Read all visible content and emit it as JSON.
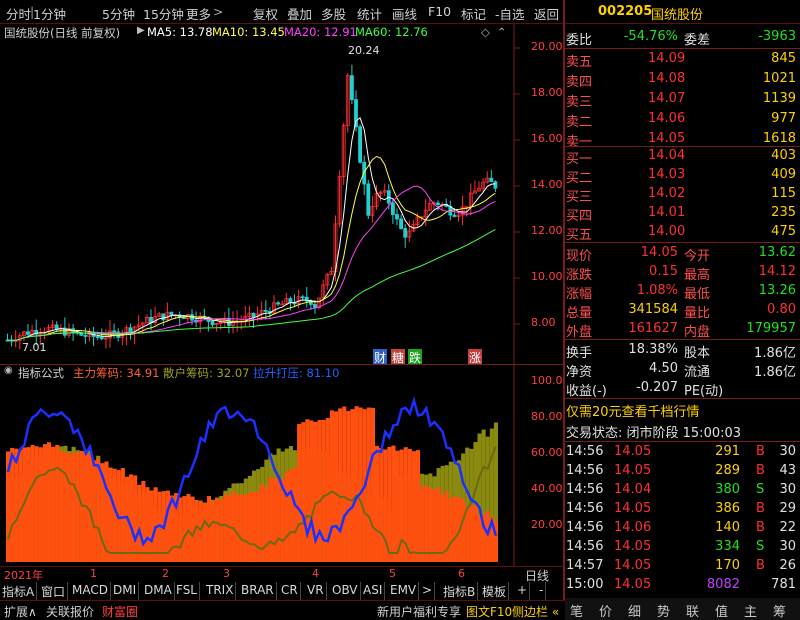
{
  "toolbar": {
    "items": [
      "分时",
      "1分钟",
      "5分钟",
      "15分钟",
      "更多",
      "复权",
      "叠加",
      "多股",
      "统计",
      "画线",
      "F10",
      "标记",
      "-自选",
      "返回"
    ]
  },
  "stock": {
    "code": "002205",
    "name": "国统股份"
  },
  "kline": {
    "title": "国统股份(日线 前复权)",
    "ma5": "MA5: 13.78",
    "ma10": "MA10: 13.45",
    "ma20": "MA20: 12.91",
    "ma60": "MA60: 12.76",
    "high_label": "20.24",
    "low_label": "7.01",
    "y_ticks": [
      "20.00",
      "18.00",
      "16.00",
      "14.00",
      "12.00",
      "10.00",
      "8.00"
    ],
    "markers": [
      "财",
      "糖",
      "跌",
      "涨"
    ]
  },
  "indicator": {
    "title": "指标公式",
    "main_label": "主力筹码: 34.91",
    "retail_label": "散户筹码: 32.07",
    "control_label": "拉升打压: 81.10",
    "y_ticks": [
      "100.0",
      "80.00",
      "60.00",
      "40.00",
      "20.00"
    ]
  },
  "xaxis": {
    "year": "2021年",
    "months": [
      "1",
      "2",
      "3",
      "4",
      "5",
      "6"
    ],
    "right_label": "日线"
  },
  "tabs": [
    "指标A",
    "窗口",
    "MACD",
    "DMI",
    "DMA",
    "FSL",
    "TRIX",
    "BRAR",
    "CR",
    "VR",
    "OBV",
    "ASI",
    "EMV",
    ">",
    "指标B",
    "模板",
    "+",
    "-"
  ],
  "statusbar": {
    "left": [
      "扩展∧",
      "关联报价",
      "财富圈"
    ],
    "mid": "新用户福利专享",
    "f10": "图文F10",
    "side": "侧边栏 «"
  },
  "side_buttons": [
    "笔",
    "价",
    "细",
    "势",
    "联",
    "值",
    "主",
    "筹"
  ],
  "quote": {
    "weibi_label": "委比",
    "weibi": "-54.76%",
    "weicha_label": "委差",
    "weicha": "-3963",
    "sells": [
      {
        "label": "卖五",
        "price": "14.09",
        "vol": "845"
      },
      {
        "label": "卖四",
        "price": "14.08",
        "vol": "1021"
      },
      {
        "label": "卖三",
        "price": "14.07",
        "vol": "1139"
      },
      {
        "label": "卖二",
        "price": "14.06",
        "vol": "977"
      },
      {
        "label": "卖一",
        "price": "14.05",
        "vol": "1618"
      }
    ],
    "buys": [
      {
        "label": "买一",
        "price": "14.04",
        "vol": "403"
      },
      {
        "label": "买二",
        "price": "14.03",
        "vol": "409"
      },
      {
        "label": "买三",
        "price": "14.02",
        "vol": "115"
      },
      {
        "label": "买四",
        "price": "14.01",
        "vol": "235"
      },
      {
        "label": "买五",
        "price": "14.00",
        "vol": "475"
      }
    ],
    "stats": [
      {
        "l1": "现价",
        "v1": "14.05",
        "l2": "今开",
        "v2": "13.62"
      },
      {
        "l1": "涨跌",
        "v1": "0.15",
        "l2": "最高",
        "v2": "14.12"
      },
      {
        "l1": "涨幅",
        "v1": "1.08%",
        "l2": "最低",
        "v2": "13.26"
      },
      {
        "l1": "总量",
        "v1": "341584",
        "l2": "量比",
        "v2": "0.80"
      },
      {
        "l1": "外盘",
        "v1": "161627",
        "l2": "内盘",
        "v2": "179957"
      }
    ],
    "stats2": [
      {
        "l1": "换手",
        "v1": "18.38%",
        "l2": "股本",
        "v2": "1.86亿"
      },
      {
        "l1": "净资",
        "v1": "4.50",
        "l2": "流通",
        "v2": "1.86亿"
      },
      {
        "l1": "收益(-)",
        "v1": "-0.207",
        "l2": "PE(动)",
        "v2": ""
      }
    ],
    "promo": "仅需20元查看千档行情",
    "trade_status": "交易状态: 闭市阶段 15:00:03",
    "ticks": [
      {
        "t": "14:56",
        "p": "14.05",
        "v": "291",
        "d": "B",
        "n": "30"
      },
      {
        "t": "14:56",
        "p": "14.05",
        "v": "289",
        "d": "B",
        "n": "43"
      },
      {
        "t": "14:56",
        "p": "14.04",
        "v": "380",
        "d": "S",
        "n": "30"
      },
      {
        "t": "14:56",
        "p": "14.05",
        "v": "386",
        "b": "",
        "d": "B",
        "n": "29"
      },
      {
        "t": "14:56",
        "p": "14.06",
        "v": "140",
        "d": "B",
        "n": "22"
      },
      {
        "t": "14:56",
        "p": "14.05",
        "v": "334",
        "d": "S",
        "n": "30"
      },
      {
        "t": "14:57",
        "p": "14.05",
        "v": "170",
        "d": "B",
        "n": "26"
      },
      {
        "t": "15:00",
        "p": "14.05",
        "v": "8082",
        "d": "",
        "n": "781"
      }
    ]
  }
}
